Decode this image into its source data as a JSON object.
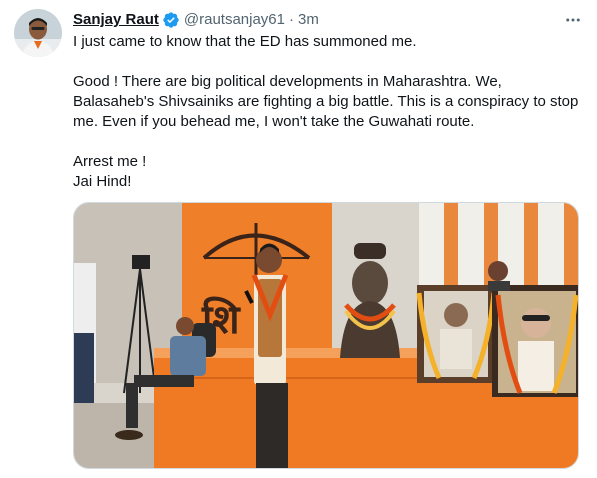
{
  "author": {
    "display_name": "Sanjay Raut",
    "handle": "@rautsanjay61",
    "separator": "·",
    "time": "3m",
    "verified_icon": "verified-badge-icon",
    "avatar_icon": "avatar-photo"
  },
  "more_icon": "more-options-icon",
  "tweet": {
    "lines": [
      "I just came to know that the ED has summoned me.",
      "",
      "Good ! There are big political developments in Maharashtra. We,",
      "Balasaheb's Shivsainiks are fighting a big battle. This is a conspiracy to stop",
      "me. Even if you behead me, I won't take the Guwahati route.",
      "",
      "Arrest me !",
      "Jai Hind!"
    ]
  },
  "media": {
    "type": "photo",
    "banner_text": "शि"
  },
  "colors": {
    "text": "#0f1419",
    "secondary": "#536471",
    "verified": "#1d9bf0",
    "border": "#cfd9de",
    "banner_orange": "#f07f2a"
  }
}
